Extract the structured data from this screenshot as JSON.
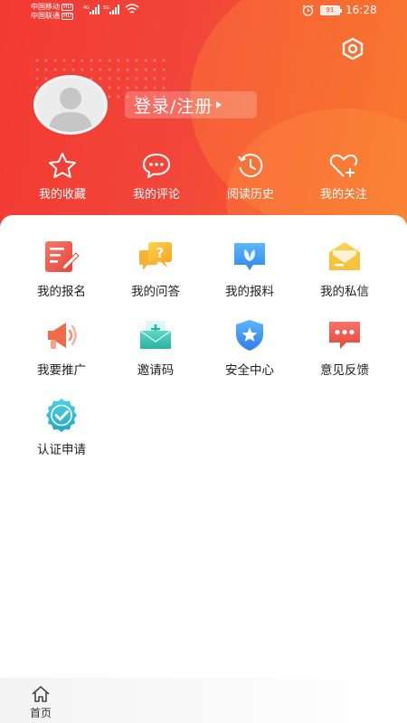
{
  "status_bar": {
    "carrier1": "中国移动",
    "carrier2": "中国联通",
    "hd": "HD",
    "net1": "4G",
    "net2": "5G",
    "battery": "91",
    "time": "16:28"
  },
  "profile": {
    "login_label": "登录/注册"
  },
  "quick_actions": [
    {
      "label": "我的收藏",
      "icon": "star-icon"
    },
    {
      "label": "我的评论",
      "icon": "comment-icon"
    },
    {
      "label": "阅读历史",
      "icon": "history-icon"
    },
    {
      "label": "我的关注",
      "icon": "heart-plus-icon"
    }
  ],
  "menu_items": [
    {
      "label": "我的报名",
      "icon": "signup-icon"
    },
    {
      "label": "我的问答",
      "icon": "qa-icon"
    },
    {
      "label": "我的报料",
      "icon": "report-icon"
    },
    {
      "label": "我的私信",
      "icon": "mail-icon"
    },
    {
      "label": "我要推广",
      "icon": "megaphone-icon"
    },
    {
      "label": "邀请码",
      "icon": "invite-icon"
    },
    {
      "label": "安全中心",
      "icon": "shield-icon"
    },
    {
      "label": "意见反馈",
      "icon": "feedback-icon"
    },
    {
      "label": "认证申请",
      "icon": "certify-icon"
    }
  ],
  "tabbar": {
    "home_label": "首页"
  },
  "colors": {
    "header_red": "#f23a32",
    "header_orange": "#f7702a"
  }
}
